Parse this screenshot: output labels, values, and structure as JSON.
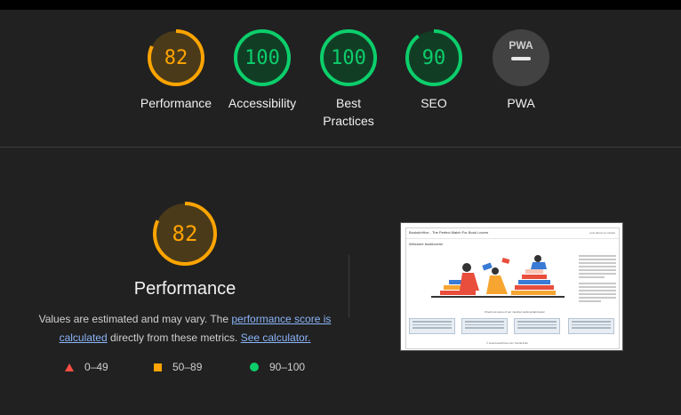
{
  "scores": [
    {
      "value": "82",
      "label": "Performance",
      "status": "average",
      "color": "#ffa400",
      "track": "#4a3a1a",
      "fraction": 0.82
    },
    {
      "value": "100",
      "label": "Accessibility",
      "status": "pass",
      "color": "#0cce6b",
      "track": "#123d25",
      "fraction": 1.0
    },
    {
      "value": "100",
      "label": "Best Practices",
      "status": "pass",
      "color": "#0cce6b",
      "track": "#123d25",
      "fraction": 1.0
    },
    {
      "value": "90",
      "label": "SEO",
      "status": "pass",
      "color": "#0cce6b",
      "track": "#123d25",
      "fraction": 0.9
    },
    {
      "value": "PWA",
      "label": "PWA",
      "status": "na",
      "color": "#d0d0d0",
      "track": "#3a3a3a",
      "fraction": 0
    }
  ],
  "performance": {
    "score": "82",
    "title": "Performance",
    "desc_prefix": "Values are estimated and may vary. The ",
    "desc_link1": "performance score is calculated",
    "desc_middle": " directly from these metrics. ",
    "desc_link2": "See calculator."
  },
  "legend": [
    {
      "icon": "triangle-icon",
      "range": "0–49",
      "color": "#ff4e42"
    },
    {
      "icon": "square-icon",
      "range": "50–89",
      "color": "#ffa400"
    },
    {
      "icon": "circle-icon",
      "range": "90–100",
      "color": "#0cce6b"
    }
  ],
  "screenshot": {
    "title": "BooksInHive - The Perfect Match For Book Lovers",
    "nav": "post   about us   contact",
    "welcome": "Welcome booklovers!",
    "caption": "Check out some of our member testimonials below:",
    "footer": "© www.bookinhive.com  Social links"
  }
}
